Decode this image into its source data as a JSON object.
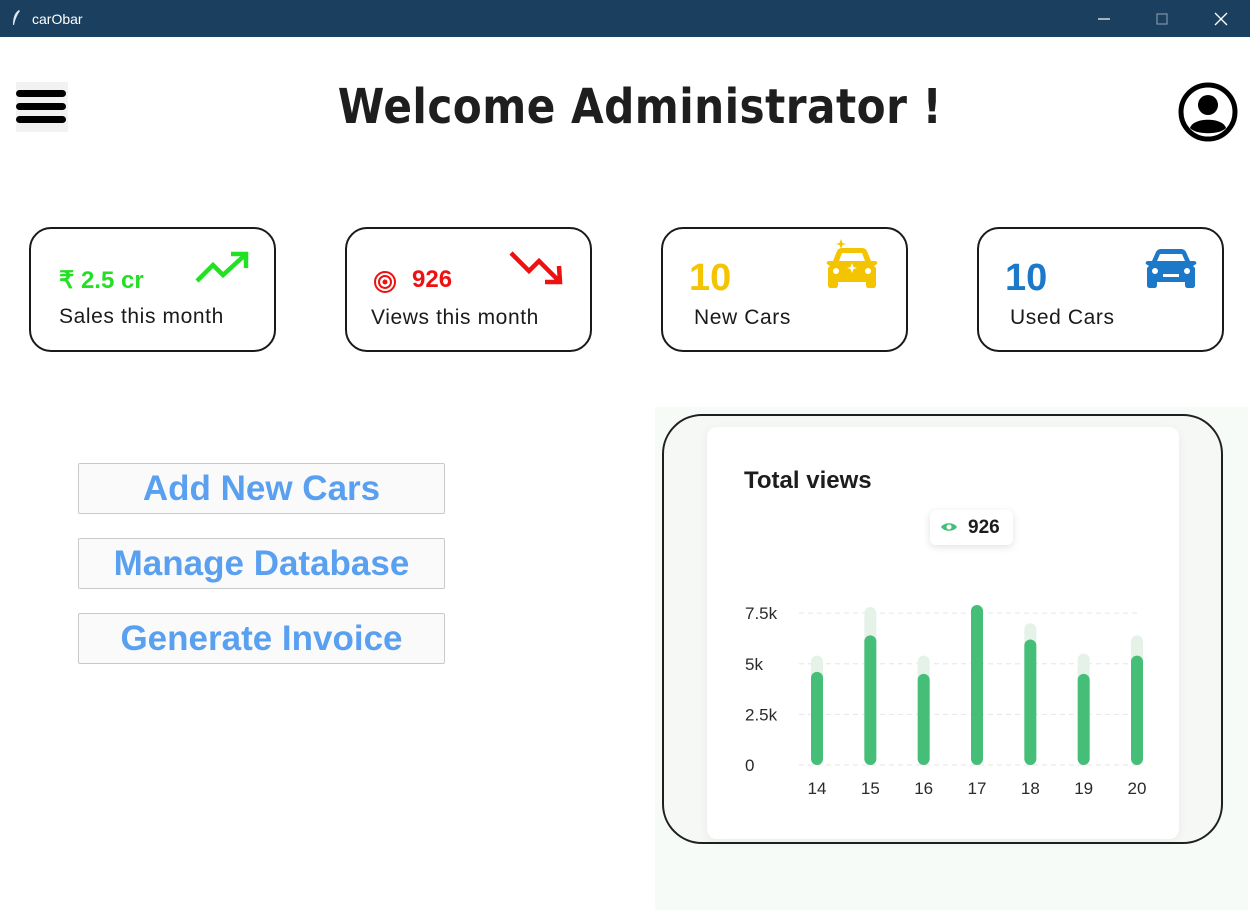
{
  "window": {
    "title": "carObar",
    "minimize_glyph": "minimize-icon",
    "maximize_glyph": "maximize-icon",
    "close_glyph": "close-icon"
  },
  "header": {
    "welcome": "Welcome Administrator !"
  },
  "cards": [
    {
      "value": "₹ 2.5 cr",
      "label": "Sales this month",
      "color": "#22e022",
      "icon": "trend-up-icon"
    },
    {
      "value": "926",
      "label": "Views this month",
      "color": "#ee1111",
      "icon": "trend-down-icon",
      "prefix_icon": "target-icon"
    },
    {
      "value": "10",
      "label": "New Cars",
      "color": "#f5c400",
      "icon": "new-car-icon"
    },
    {
      "value": "10",
      "label": "Used Cars",
      "color": "#1c78c8",
      "icon": "car-icon"
    }
  ],
  "actions": {
    "add_new_cars": "Add New Cars",
    "manage_database": "Manage Database",
    "generate_invoice": "Generate Invoice"
  },
  "chart_data": {
    "type": "bar",
    "title": "Total views",
    "categories": [
      "14",
      "15",
      "16",
      "17",
      "18",
      "19",
      "20"
    ],
    "values": [
      4600,
      6400,
      4500,
      7900,
      6200,
      4500,
      5400
    ],
    "background_values": [
      5400,
      7800,
      5400,
      7800,
      7000,
      5500,
      6400
    ],
    "y_ticks": [
      "0",
      "2.5k",
      "5k",
      "7.5k"
    ],
    "y_tick_values": [
      0,
      2500,
      5000,
      7500
    ],
    "ylim": [
      0,
      8000
    ],
    "tooltip": {
      "category": "17",
      "value": "926"
    },
    "colors": {
      "bar": "#45be78",
      "bar_bg": "#e5f2e8",
      "grid": "#e6e6e6"
    }
  }
}
